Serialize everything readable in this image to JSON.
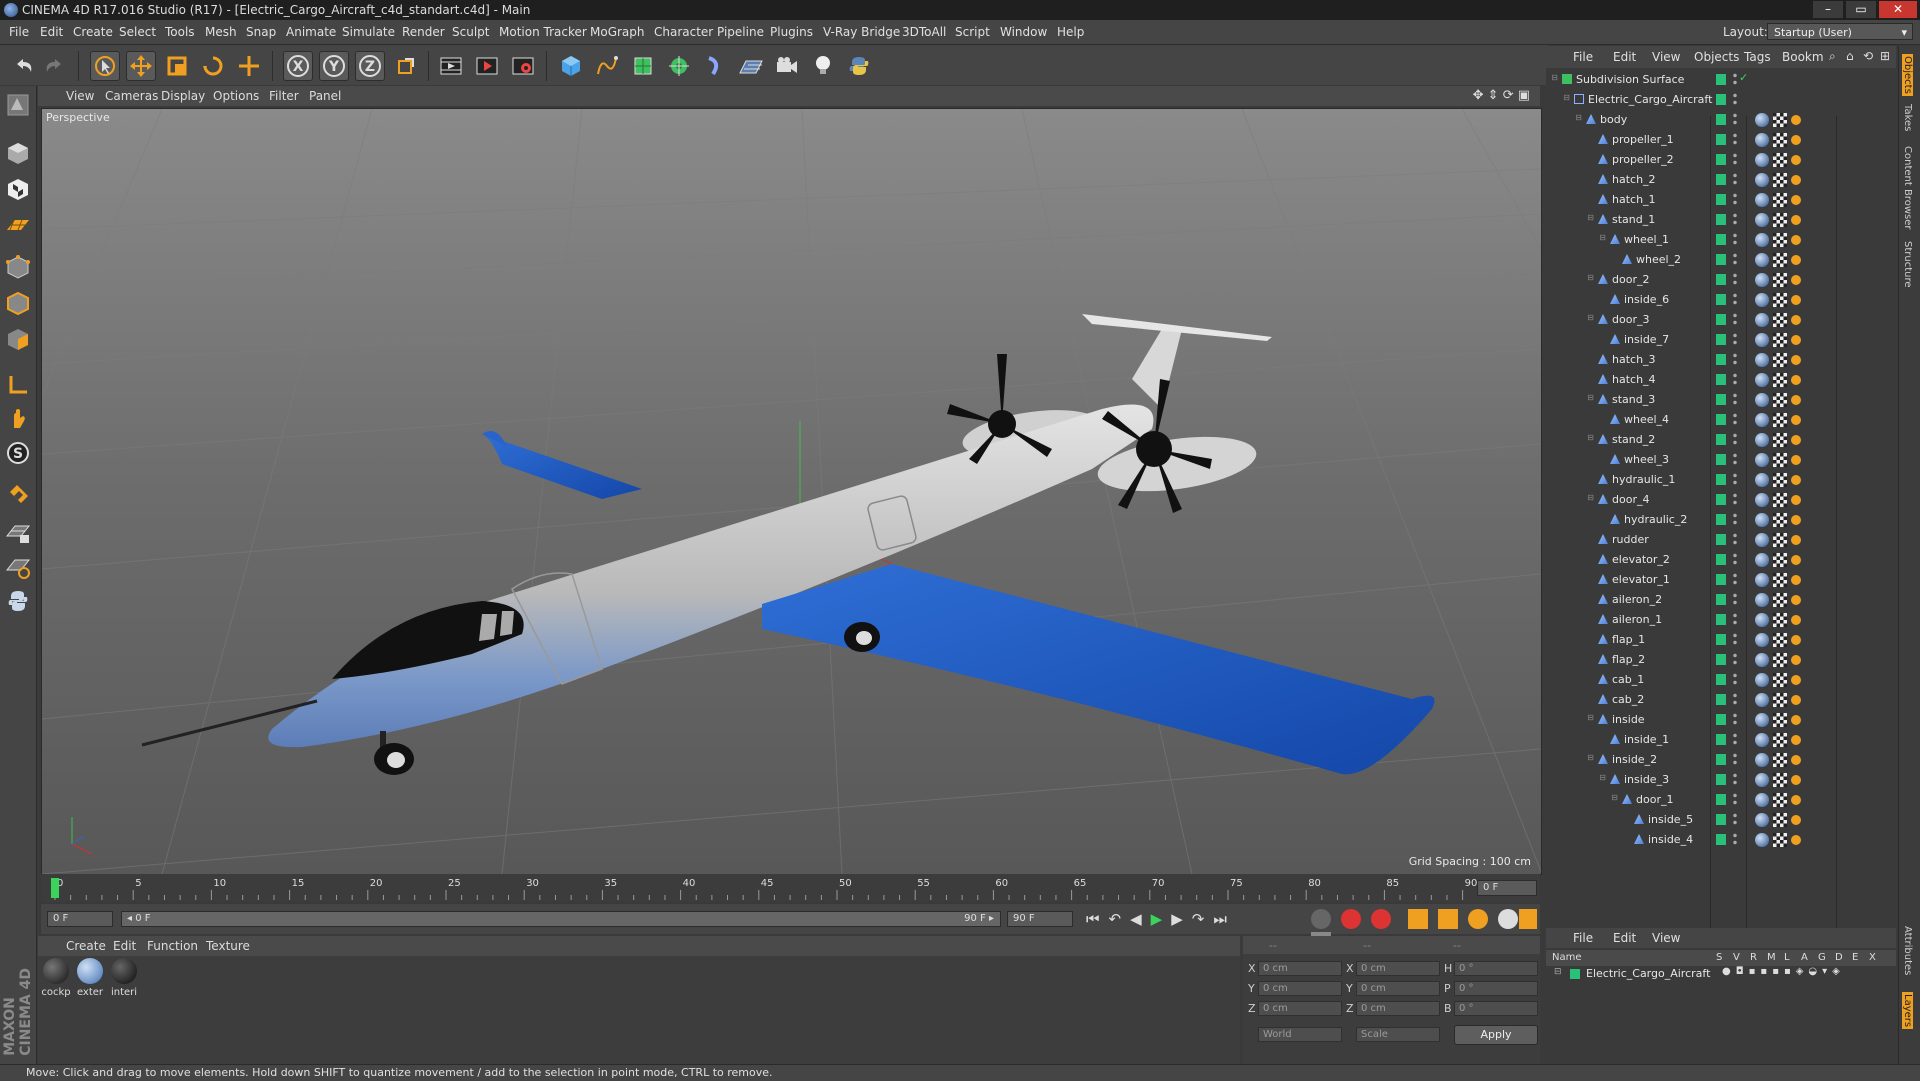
{
  "window": {
    "title": "CINEMA 4D R17.016 Studio (R17) - [Electric_Cargo_Aircraft_c4d_standart.c4d] - Main",
    "controls": [
      "–",
      "▭",
      "✕"
    ]
  },
  "menubar": {
    "items": [
      "File",
      "Edit",
      "Create",
      "Select",
      "Tools",
      "Mesh",
      "Snap",
      "Animate",
      "Simulate",
      "Render",
      "Sculpt",
      "Motion Tracker",
      "MoGraph",
      "Character",
      "Pipeline",
      "Plugins",
      "V-Ray Bridge",
      "3DToAll",
      "Script",
      "Window",
      "Help"
    ],
    "layout_label": "Layout:",
    "layout_value": "Startup (User)"
  },
  "toolbar": {
    "axis_labels": [
      "X",
      "Y",
      "Z"
    ]
  },
  "viewport": {
    "menu": [
      "View",
      "Cameras",
      "Display",
      "Options",
      "Filter",
      "Panel"
    ],
    "label": "Perspective",
    "grid_spacing": "Grid Spacing : 100 cm"
  },
  "timeline": {
    "ticks": [
      "0",
      "5",
      "10",
      "15",
      "20",
      "25",
      "30",
      "35",
      "40",
      "45",
      "50",
      "55",
      "60",
      "65",
      "70",
      "75",
      "80",
      "85",
      "90"
    ],
    "current_frame": "0 F",
    "start_field": "0 F",
    "range_start": "◂ 0 F",
    "range_end": "90 F ▸",
    "end_field": "90 F"
  },
  "material_manager": {
    "menu": [
      "Create",
      "Edit",
      "Function",
      "Texture"
    ],
    "materials": [
      {
        "label": "cockp",
        "color": "#1e1e1e"
      },
      {
        "label": "exter",
        "color": "#4a7fc0"
      },
      {
        "label": "interi",
        "color": "#151515"
      }
    ]
  },
  "attributes": {
    "header": [
      "--",
      "--",
      "--"
    ],
    "rows": [
      {
        "l1": "X",
        "v1": "0 cm",
        "l2": "X",
        "v2": "0 cm",
        "l3": "H",
        "v3": "0 °"
      },
      {
        "l1": "Y",
        "v1": "0 cm",
        "l2": "Y",
        "v2": "0 cm",
        "l3": "P",
        "v3": "0 °"
      },
      {
        "l1": "Z",
        "v1": "0 cm",
        "l2": "Z",
        "v2": "0 cm",
        "l3": "B",
        "v3": "0 °"
      }
    ],
    "coord_mode": "World",
    "size_mode": "Scale",
    "apply": "Apply"
  },
  "status_bar": {
    "text": "Move: Click and drag to move elements. Hold down SHIFT to quantize movement / add to the selection in point mode, CTRL to remove."
  },
  "object_manager": {
    "menu": [
      "File",
      "Edit",
      "View",
      "Objects",
      "Tags",
      "Bookm"
    ],
    "objects": [
      {
        "name": "Subdivision Surface",
        "depth": 0,
        "kind": "subd",
        "expand": "⊟"
      },
      {
        "name": "Electric_Cargo_Aircraft",
        "depth": 1,
        "kind": "null",
        "expand": "⊟"
      },
      {
        "name": "body",
        "depth": 2,
        "kind": "poly",
        "expand": "⊟"
      },
      {
        "name": "propeller_1",
        "depth": 3,
        "kind": "poly",
        "expand": ""
      },
      {
        "name": "propeller_2",
        "depth": 3,
        "kind": "poly",
        "expand": ""
      },
      {
        "name": "hatch_2",
        "depth": 3,
        "kind": "poly",
        "expand": ""
      },
      {
        "name": "hatch_1",
        "depth": 3,
        "kind": "poly",
        "expand": ""
      },
      {
        "name": "stand_1",
        "depth": 3,
        "kind": "poly",
        "expand": "⊟"
      },
      {
        "name": "wheel_1",
        "depth": 4,
        "kind": "poly",
        "expand": "⊟"
      },
      {
        "name": "wheel_2",
        "depth": 5,
        "kind": "poly",
        "expand": ""
      },
      {
        "name": "door_2",
        "depth": 3,
        "kind": "poly",
        "expand": "⊟"
      },
      {
        "name": "inside_6",
        "depth": 4,
        "kind": "poly",
        "expand": ""
      },
      {
        "name": "door_3",
        "depth": 3,
        "kind": "poly",
        "expand": "⊟"
      },
      {
        "name": "inside_7",
        "depth": 4,
        "kind": "poly",
        "expand": ""
      },
      {
        "name": "hatch_3",
        "depth": 3,
        "kind": "poly",
        "expand": ""
      },
      {
        "name": "hatch_4",
        "depth": 3,
        "kind": "poly",
        "expand": ""
      },
      {
        "name": "stand_3",
        "depth": 3,
        "kind": "poly",
        "expand": "⊟"
      },
      {
        "name": "wheel_4",
        "depth": 4,
        "kind": "poly",
        "expand": ""
      },
      {
        "name": "stand_2",
        "depth": 3,
        "kind": "poly",
        "expand": "⊟"
      },
      {
        "name": "wheel_3",
        "depth": 4,
        "kind": "poly",
        "expand": ""
      },
      {
        "name": "hydraulic_1",
        "depth": 3,
        "kind": "poly",
        "expand": ""
      },
      {
        "name": "door_4",
        "depth": 3,
        "kind": "poly",
        "expand": "⊟"
      },
      {
        "name": "hydraulic_2",
        "depth": 4,
        "kind": "poly",
        "expand": ""
      },
      {
        "name": "rudder",
        "depth": 3,
        "kind": "poly",
        "expand": ""
      },
      {
        "name": "elevator_2",
        "depth": 3,
        "kind": "poly",
        "expand": ""
      },
      {
        "name": "elevator_1",
        "depth": 3,
        "kind": "poly",
        "expand": ""
      },
      {
        "name": "aileron_2",
        "depth": 3,
        "kind": "poly",
        "expand": ""
      },
      {
        "name": "aileron_1",
        "depth": 3,
        "kind": "poly",
        "expand": ""
      },
      {
        "name": "flap_1",
        "depth": 3,
        "kind": "poly",
        "expand": ""
      },
      {
        "name": "flap_2",
        "depth": 3,
        "kind": "poly",
        "expand": ""
      },
      {
        "name": "cab_1",
        "depth": 3,
        "kind": "poly",
        "expand": ""
      },
      {
        "name": "cab_2",
        "depth": 3,
        "kind": "poly",
        "expand": ""
      },
      {
        "name": "inside",
        "depth": 3,
        "kind": "poly",
        "expand": "⊟"
      },
      {
        "name": "inside_1",
        "depth": 4,
        "kind": "poly",
        "expand": ""
      },
      {
        "name": "inside_2",
        "depth": 3,
        "kind": "poly",
        "expand": "⊟"
      },
      {
        "name": "inside_3",
        "depth": 4,
        "kind": "poly",
        "expand": "⊟"
      },
      {
        "name": "door_1",
        "depth": 5,
        "kind": "poly",
        "expand": "⊟"
      },
      {
        "name": "inside_5",
        "depth": 6,
        "kind": "poly",
        "expand": ""
      },
      {
        "name": "inside_4",
        "depth": 6,
        "kind": "poly",
        "expand": ""
      }
    ]
  },
  "layer_manager": {
    "menu": [
      "File",
      "Edit",
      "View"
    ],
    "columns": [
      "Name",
      "S",
      "V",
      "R",
      "M",
      "L",
      "A",
      "G",
      "D",
      "E",
      "X"
    ],
    "layer_name": "Electric_Cargo_Aircraft"
  },
  "right_tabs": [
    "Objects",
    "Takes",
    "Content Browser",
    "Structure",
    "Attributes",
    "Layers"
  ],
  "colors": {
    "accent_orange": "#f0a020",
    "layer_green": "#29c07a",
    "aircraft_blue": "#1f5fc8"
  }
}
